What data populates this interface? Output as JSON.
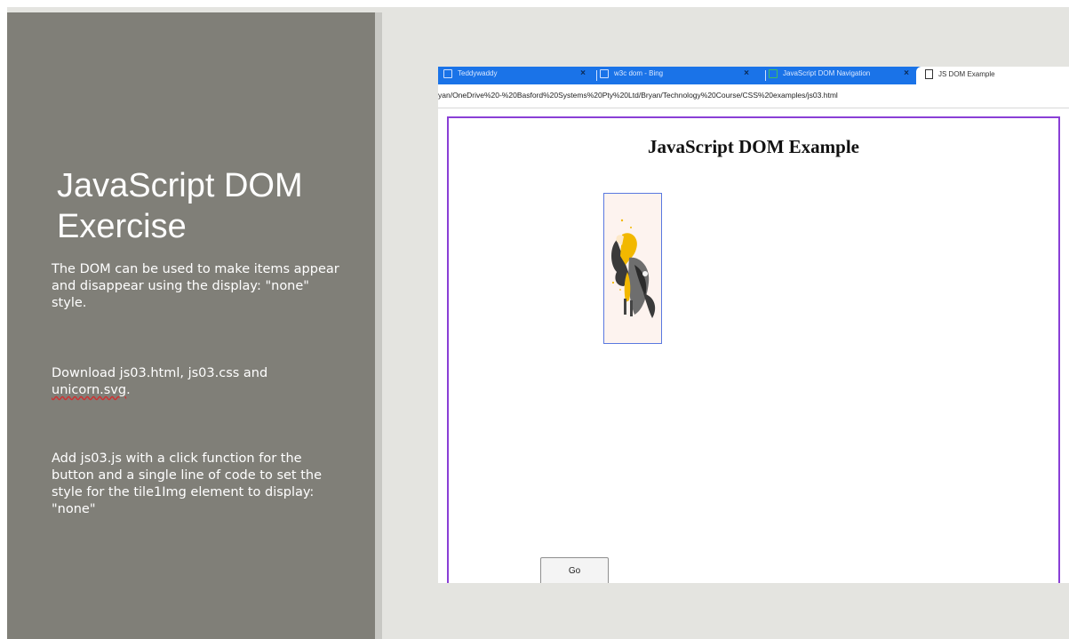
{
  "slide": {
    "title": "JavaScript DOM Exercise",
    "paragraph1": "The DOM can be used to make items appear and disappear using the display: \"none\" style.",
    "paragraph2_text": "Download js03.html, js03.css and ",
    "paragraph2_link": "unicorn.svg",
    "paragraph2_end": ".",
    "paragraph3": "Add js03.js with a click function for the button and a single line of code to set the style for the tile1Img  element to display: \"none\""
  },
  "browser": {
    "tabs": [
      {
        "label": "Teddywaddy",
        "close": "×"
      },
      {
        "label": "w3c dom - Bing",
        "close": "×"
      },
      {
        "label": "JavaScript DOM Navigation",
        "close": "×"
      }
    ],
    "active_tab": {
      "label": "JS DOM Example"
    },
    "url": "yan/OneDrive%20-%20Basford%20Systems%20Pty%20Ltd/Bryan/Technology%20Course/CSS%20examples/js03.html",
    "page": {
      "heading": "JavaScript DOM Example",
      "go_button": "Go"
    }
  },
  "colors": {
    "left_panel": "#807f78",
    "background": "#e4e4e0",
    "tab_bar": "#1a73e8",
    "page_border": "#8a3fd6",
    "tile_border": "#5a78e0"
  }
}
